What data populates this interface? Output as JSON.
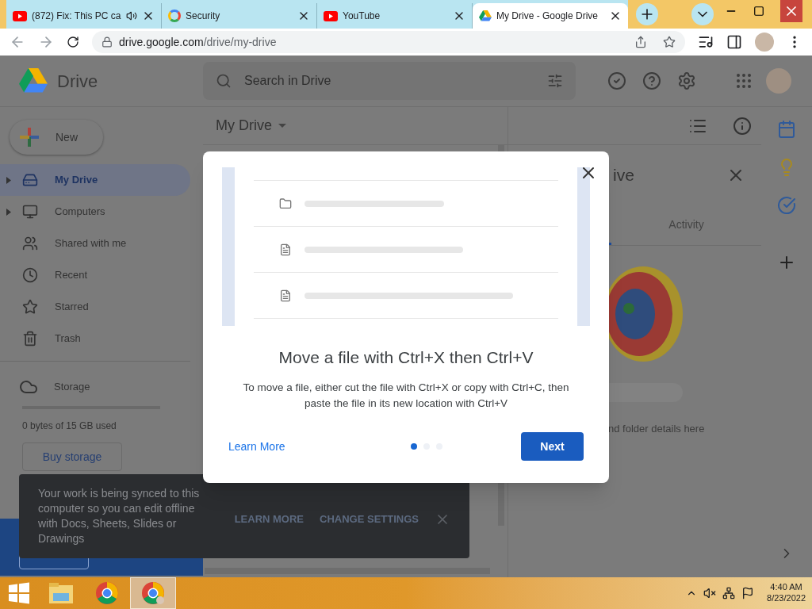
{
  "browser": {
    "tabs": [
      {
        "title": "(872) Fix: This PC ca",
        "kind": "video",
        "audio": true,
        "selected": false
      },
      {
        "title": "Security",
        "kind": "search",
        "audio": false,
        "selected": false
      },
      {
        "title": "YouTube",
        "kind": "video",
        "audio": false,
        "selected": false
      },
      {
        "title": "My Drive - Google Drive",
        "kind": "drive",
        "audio": false,
        "selected": true
      }
    ],
    "url_host": "drive.google.com",
    "url_path": "/drive/my-drive"
  },
  "drive": {
    "app_name": "Drive",
    "search": {
      "placeholder": "Search in Drive"
    },
    "new_button": "New",
    "sidebar": {
      "items": [
        {
          "label": "My Drive",
          "expandable": true,
          "selected": true
        },
        {
          "label": "Computers",
          "expandable": true,
          "selected": false
        },
        {
          "label": "Shared with me",
          "expandable": false,
          "selected": false
        },
        {
          "label": "Recent",
          "expandable": false,
          "selected": false
        },
        {
          "label": "Starred",
          "expandable": false,
          "selected": false
        },
        {
          "label": "Trash",
          "expandable": false,
          "selected": false
        }
      ],
      "storage": {
        "label": "Storage",
        "usage": "0 bytes of 15 GB used",
        "button": "Buy storage"
      }
    },
    "main_title": "My Drive",
    "details": {
      "title": "ive",
      "tabs": [
        {
          "label": "Activity",
          "selected": false
        }
      ],
      "hint": "nd folder details here"
    }
  },
  "dialog": {
    "title": "Move a file with Ctrl+X then Ctrl+V",
    "body": "To move a file, either cut the file with Ctrl+X or copy with Ctrl+C, then paste the file in its new location with Ctrl+V",
    "link": "Learn More",
    "button": "Next",
    "preview_rows": [
      {
        "kind": "folder"
      },
      {
        "kind": "doc"
      },
      {
        "kind": "doc"
      }
    ],
    "pages": [
      {
        "selected": true
      },
      {
        "selected": false
      },
      {
        "selected": false
      }
    ]
  },
  "snackbar": {
    "message": "Your work is being synced to this computer so you can edit offline with Docs, Sheets, Slides or Drawings",
    "actions": [
      "LEARN MORE",
      "CHANGE SETTINGS"
    ]
  },
  "taskbar": {
    "apps": [
      {
        "kind": "explorer",
        "selected": false
      },
      {
        "kind": "chrome",
        "selected": false
      },
      {
        "kind": "chrome-profile",
        "selected": true
      }
    ],
    "time": "4:40 AM",
    "date": "8/23/2022"
  }
}
